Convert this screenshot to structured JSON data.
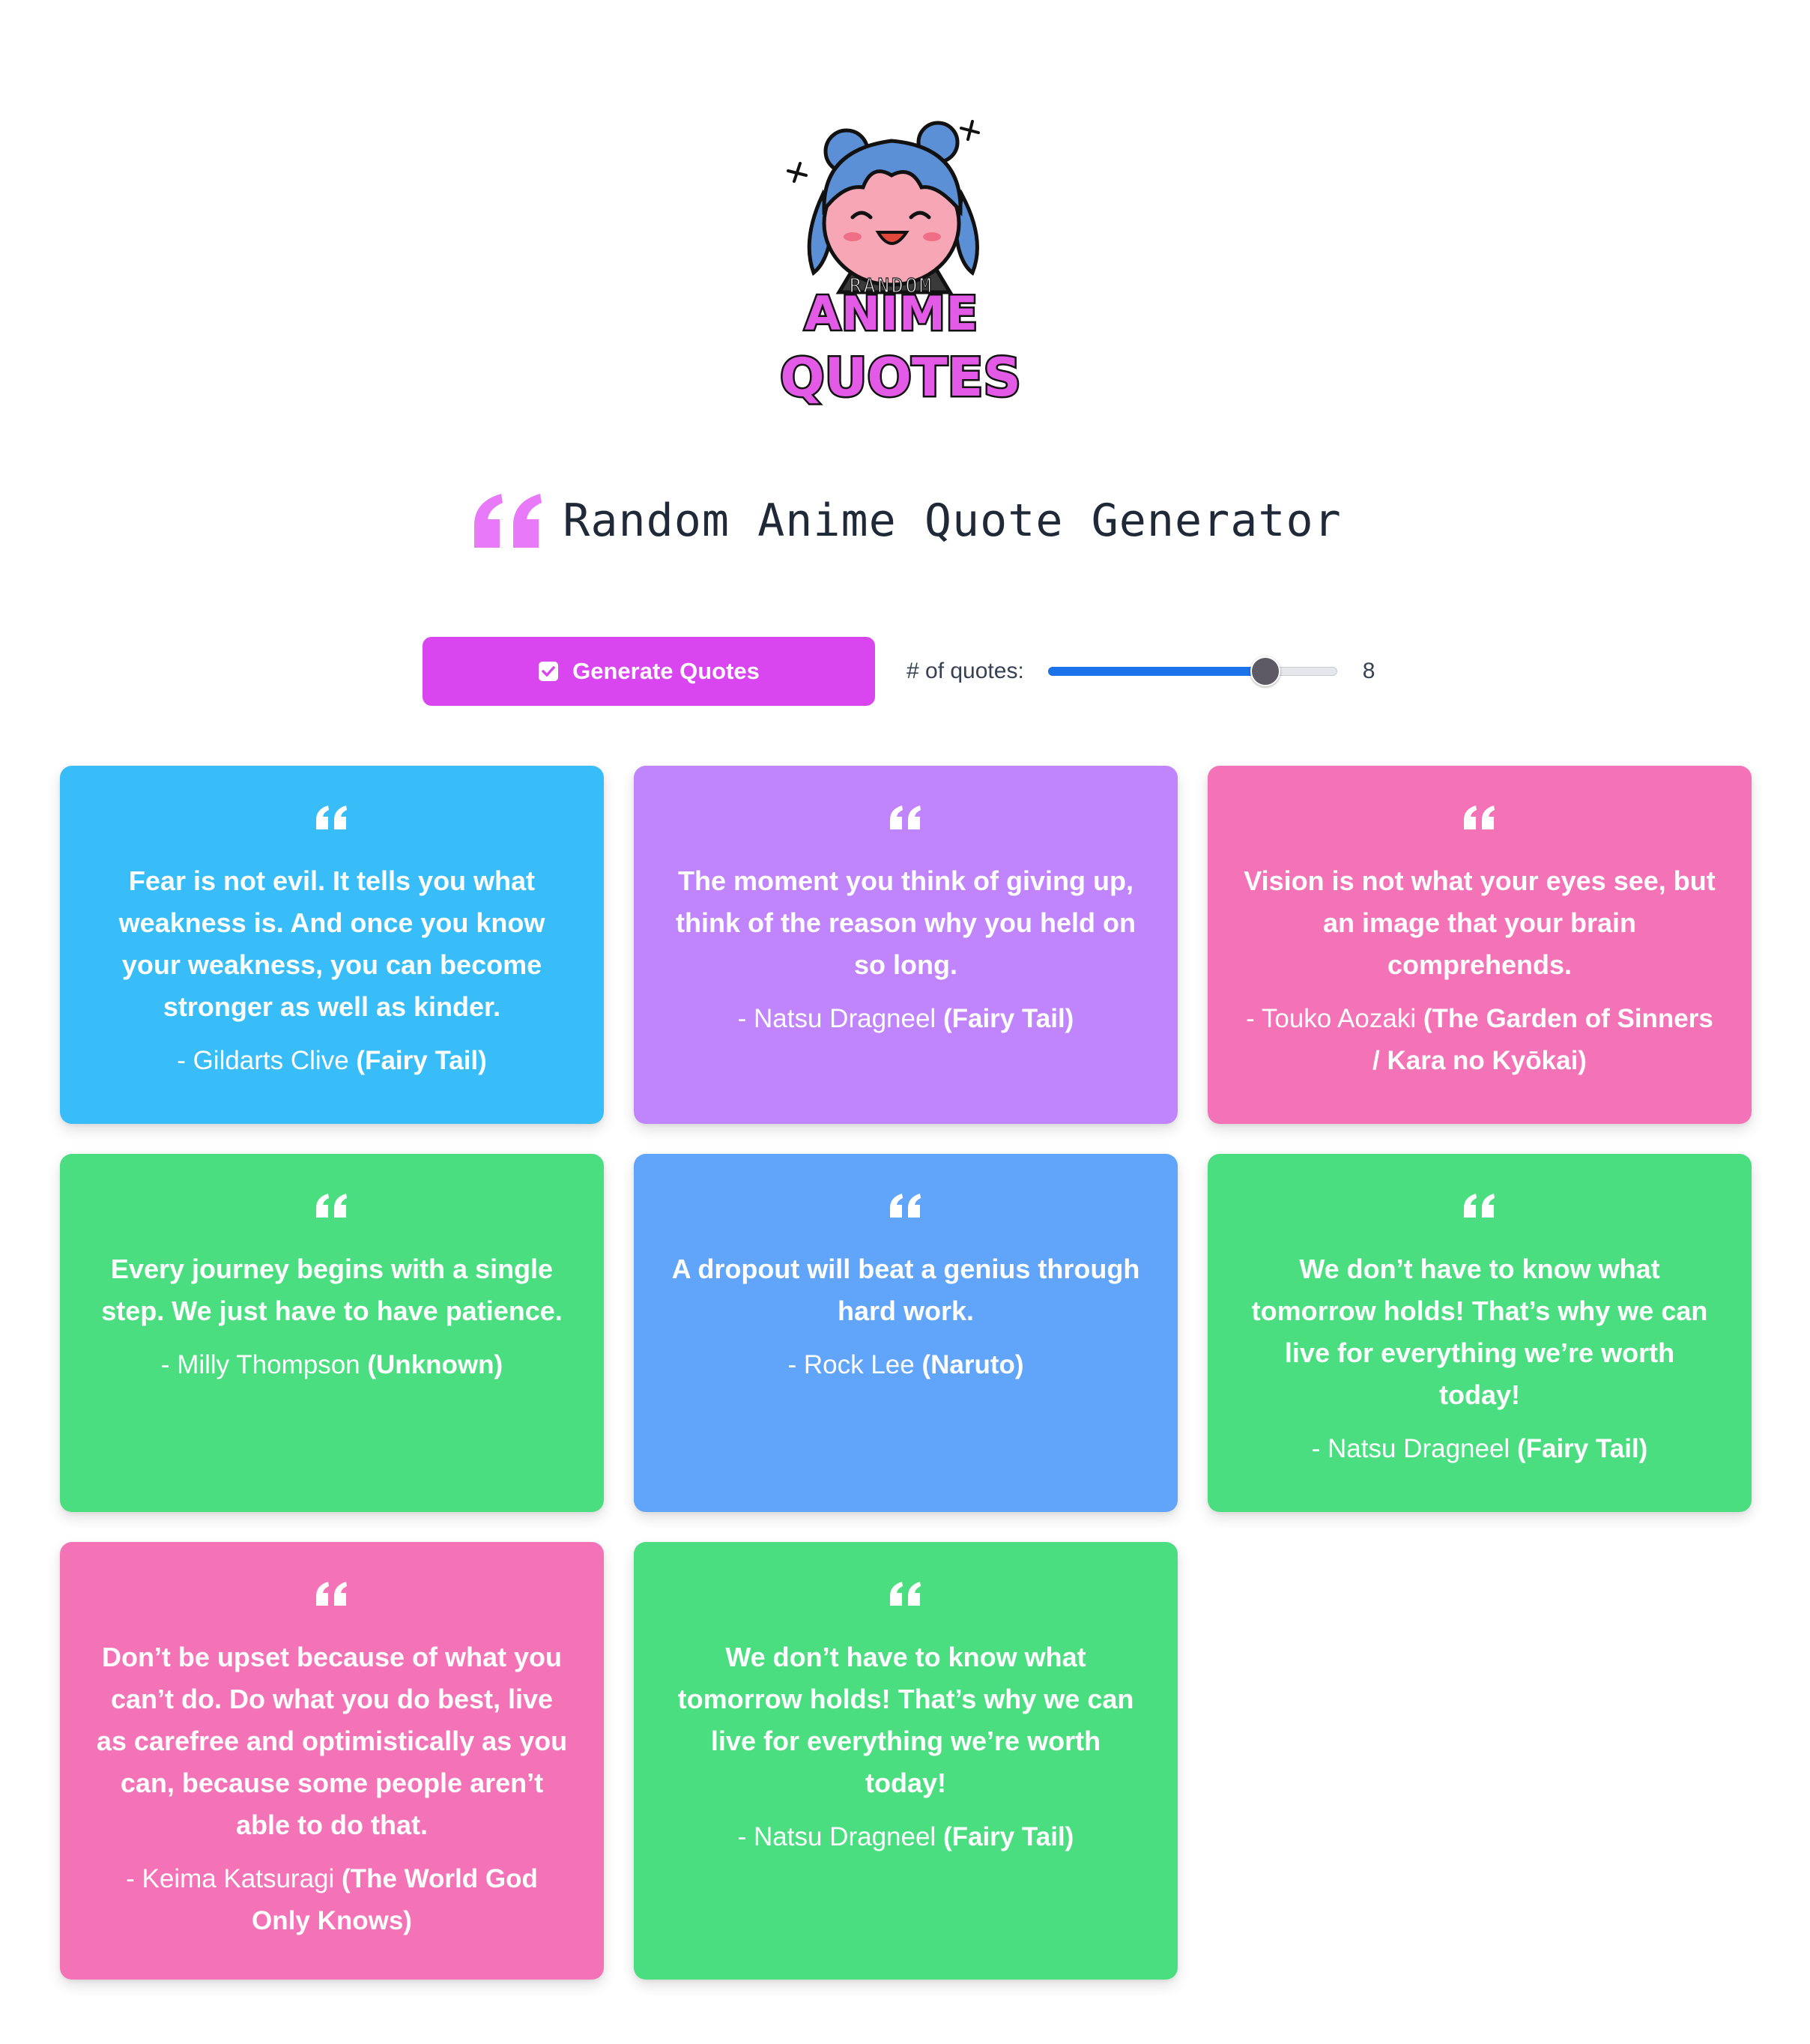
{
  "logo": {
    "word_top": "RANDOM",
    "word_mid": "ANIME",
    "word_bottom": "QUOTES"
  },
  "header": {
    "quote_icon": "quote-left-icon",
    "title": "Random Anime Quote Generator"
  },
  "controls": {
    "generate_label": "Generate Quotes",
    "generate_icon": "checkbox-icon",
    "count_label": "# of quotes:",
    "count_value": "8",
    "slider_fraction": 0.75
  },
  "colors": {
    "accent": "#d946ef",
    "sky": "#38bdf8",
    "purple": "#c084fc",
    "pink": "#f472b6",
    "green": "#4ade80",
    "blue": "#60a5fa"
  },
  "quotes": [
    {
      "text": "Fear is not evil. It tells you what weakness is. And once you know your weakness, you can become stronger as well as kinder.",
      "character": "- Gildarts Clive",
      "anime": "(Fairy Tail)",
      "color": "#38bdf8"
    },
    {
      "text": "The moment you think of giving up, think of the reason why you held on so long.",
      "character": "- Natsu Dragneel",
      "anime": "(Fairy Tail)",
      "color": "#c084fc"
    },
    {
      "text": "Vision is not what your eyes see, but an image that your brain comprehends.",
      "character": "- Touko Aozaki",
      "anime": "(The Garden of Sinners / Kara no Kyōkai)",
      "color": "#f472b6"
    },
    {
      "text": "Every journey begins with a single step. We just have to have patience.",
      "character": "- Milly Thompson",
      "anime": "(Unknown)",
      "color": "#4ade80"
    },
    {
      "text": "A dropout will beat a genius through hard work.",
      "character": "- Rock Lee",
      "anime": "(Naruto)",
      "color": "#60a5fa"
    },
    {
      "text": "We don’t have to know what tomorrow holds! That’s why we can live for everything we’re worth today!",
      "character": "- Natsu Dragneel",
      "anime": "(Fairy Tail)",
      "color": "#4ade80"
    },
    {
      "text": "Don’t be upset because of what you can’t do. Do what you do best, live as carefree and optimistically as you can, because some people aren’t able to do that.",
      "character": "- Keima Katsuragi",
      "anime": "(The World God Only Knows)",
      "color": "#f472b6"
    },
    {
      "text": "We don’t have to know what tomorrow holds! That’s why we can live for everything we’re worth today!",
      "character": "- Natsu Dragneel",
      "anime": "(Fairy Tail)",
      "color": "#4ade80"
    }
  ]
}
